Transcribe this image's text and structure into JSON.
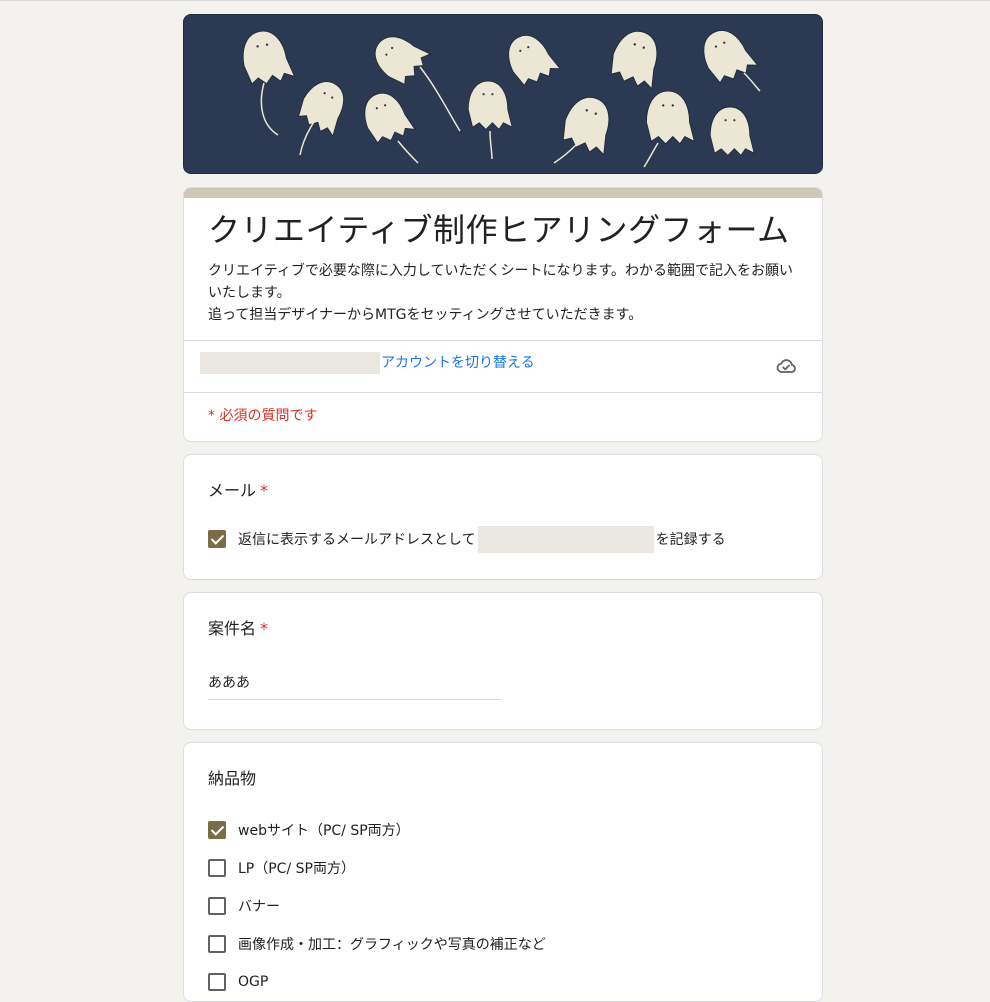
{
  "form": {
    "title": "クリエイティブ制作ヒアリングフォーム",
    "description": "クリエイティブで必要な際に入力していただくシートになります。わかる範囲で記入をお願いいたします。\n追って担当デザイナーからMTGをセッティングさせていただきます。",
    "switch_account": "アカウントを切り替える",
    "required_note": "* 必須の質問です"
  },
  "email_question": {
    "title": "メール",
    "required_mark": "*",
    "record_prefix": "返信に表示するメールアドレスとして",
    "record_suffix": "を記録する",
    "checked": true
  },
  "project_question": {
    "title": "案件名",
    "required_mark": "*",
    "answer": "あああ"
  },
  "deliverables_question": {
    "title": "納品物",
    "options": [
      {
        "label": "webサイト（PC/ SP両方）",
        "checked": true
      },
      {
        "label": "LP（PC/ SP両方）",
        "checked": false
      },
      {
        "label": "バナー",
        "checked": false
      },
      {
        "label": "画像作成・加工：グラフィックや写真の補正など",
        "checked": false
      },
      {
        "label": "OGP",
        "checked": false
      }
    ]
  },
  "colors": {
    "accent": "#7a6c45",
    "link": "#1a73e8",
    "required": "#d93025",
    "header_bg": "#2b3a52",
    "title_accent_bar": "#cfc8b6"
  },
  "icons": {
    "cloud": "cloud-saved-icon",
    "checkbox_checked": "checkmark"
  }
}
